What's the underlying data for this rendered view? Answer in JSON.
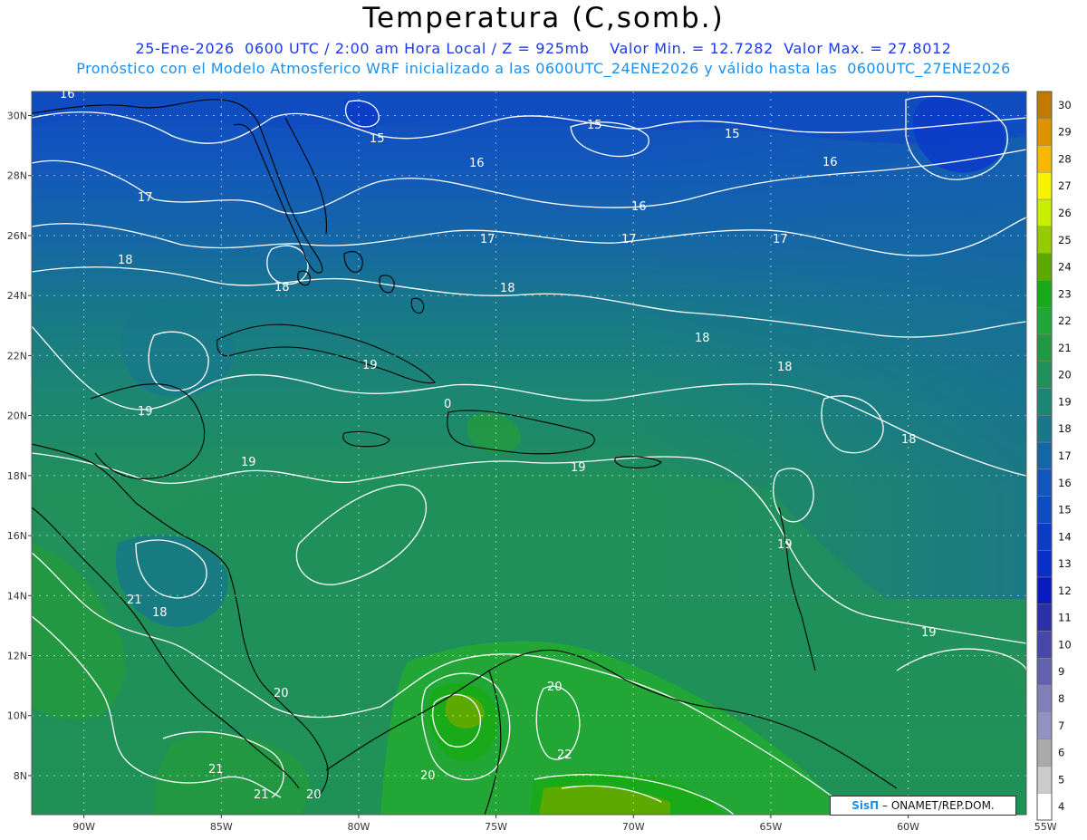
{
  "header": {
    "title": "Temperatura (C,somb.)",
    "line1": "25-Ene-2026  0600 UTC / 2:00 am Hora Local / Z = 925mb    Valor Min. = 12.7282  Valor Max. = 27.8012",
    "line2": "Pronóstico con el Modelo Atmosferico WRF inicializado a las 0600UTC_24ENE2026 y válido hasta las  0600UTC_27ENE2026"
  },
  "axes": {
    "lat_labels": [
      "30N",
      "28N",
      "26N",
      "24N",
      "22N",
      "20N",
      "18N",
      "16N",
      "14N",
      "12N",
      "10N",
      "8N"
    ],
    "lon_labels": [
      "90W",
      "85W",
      "80W",
      "75W",
      "70W",
      "65W",
      "60W",
      "55W"
    ],
    "lat_range": [
      6.7,
      30.8
    ],
    "lon_range": [
      -91.9,
      -55.7
    ]
  },
  "colorbar": {
    "levels": [
      "30",
      "29",
      "28",
      "27",
      "26",
      "25",
      "24",
      "23",
      "22",
      "21",
      "20",
      "19",
      "18",
      "17",
      "16",
      "15",
      "14",
      "13",
      "12",
      "11",
      "10",
      "9",
      "8",
      "7",
      "6",
      "5",
      "4"
    ],
    "colors": [
      "#c07a00",
      "#dd9400",
      "#f8b800",
      "#f6f200",
      "#c6f000",
      "#94cc00",
      "#5caa00",
      "#18aa18",
      "#22a636",
      "#229842",
      "#21905a",
      "#1c8672",
      "#187889",
      "#1566a6",
      "#1256bd",
      "#0f4cbf",
      "#0b3cc6",
      "#0a2ec8",
      "#0a1cc0",
      "#2b2fa8",
      "#4747aa",
      "#6262b0",
      "#8080b8",
      "#9393c3",
      "#aaaaaa",
      "#cccccc",
      "#ffffff"
    ]
  },
  "contour_labels": [
    "15",
    "15",
    "15",
    "16",
    "16",
    "16",
    "16",
    "17",
    "17",
    "17",
    "17",
    "18",
    "18",
    "18",
    "18",
    "18",
    "18",
    "19",
    "19",
    "19",
    "19",
    "19",
    "19",
    "20",
    "20",
    "20",
    "20",
    "21",
    "21",
    "21",
    "22",
    "0"
  ],
  "credit": {
    "logo": "SisΠ",
    "org": "– ONAMET/REP.DOM."
  }
}
